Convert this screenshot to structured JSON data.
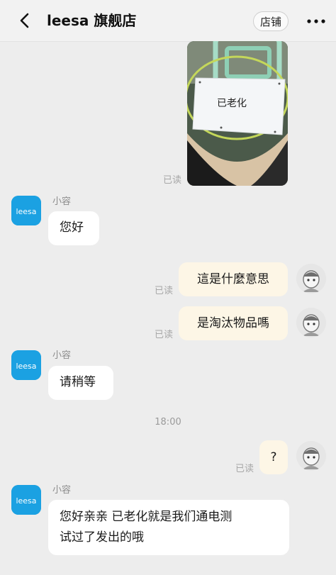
{
  "header": {
    "title": "leesa 旗舰店",
    "shop_button": "店铺"
  },
  "messages": {
    "image_caption": "已老化",
    "read_1": "已读",
    "sender_1": "小容",
    "text_1": "您好",
    "user_text_1": "這是什麼意思",
    "read_2": "已读",
    "user_text_2": "是淘汰物品嗎",
    "read_3": "已读",
    "sender_2": "小容",
    "text_2": "请稍等",
    "timestamp": "18:00",
    "user_text_3": "?",
    "read_4": "已读",
    "sender_3": "小容",
    "text_3_line1": "您好亲亲  已老化就是我们通电测",
    "text_3_line2": "试过了发出的哦"
  },
  "brand": {
    "logo_text": "leesa",
    "accent": "#1ba1e2",
    "bubble_user": "#fdf6e6",
    "bubble_agent": "#ffffff"
  },
  "icons": [
    "chevron-left-icon",
    "more-dots-icon",
    "leesa-logo",
    "user-avatar"
  ]
}
